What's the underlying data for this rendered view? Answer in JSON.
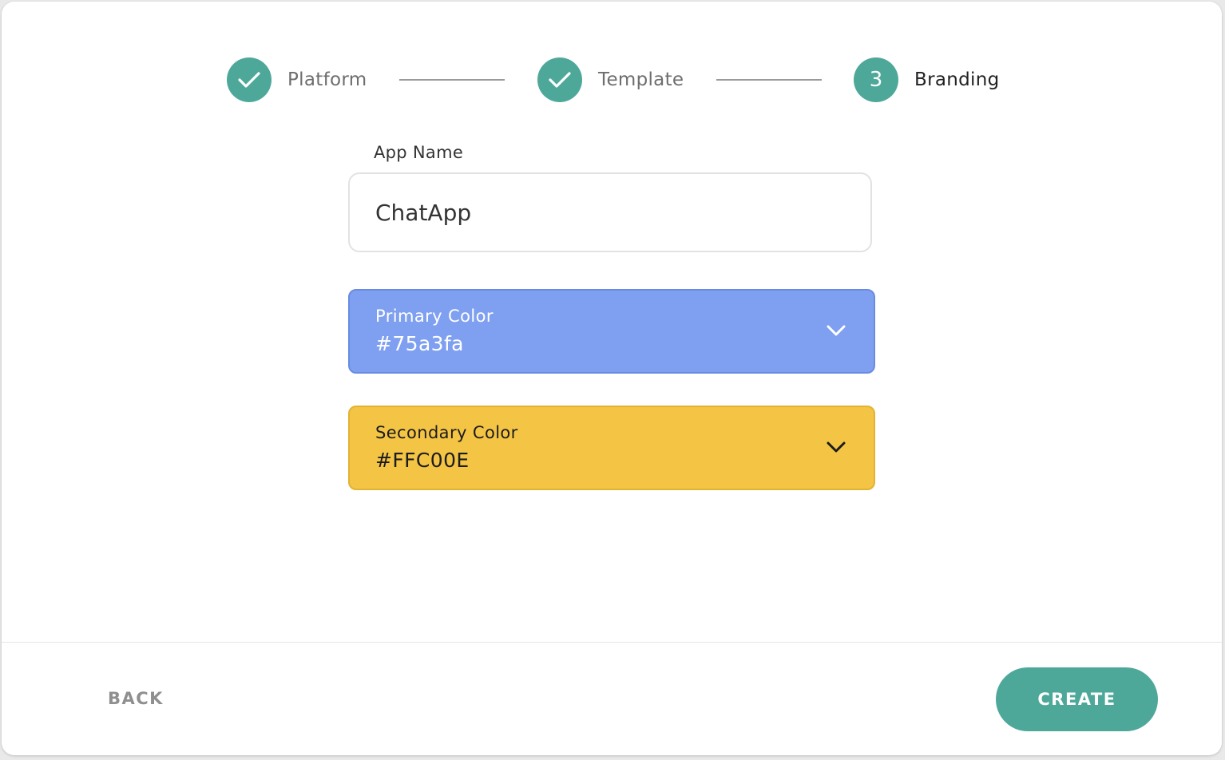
{
  "stepper": {
    "steps": [
      {
        "label": "Platform",
        "status": "completed",
        "icon": "checkmark-icon"
      },
      {
        "label": "Template",
        "status": "completed",
        "icon": "checkmark-icon"
      },
      {
        "label": "Branding",
        "status": "active",
        "number": "3"
      }
    ]
  },
  "form": {
    "app_name": {
      "label": "App Name",
      "value": "ChatApp"
    },
    "primary_color": {
      "label": "Primary Color",
      "value": "#75a3fa",
      "icon": "chevron-down-icon"
    },
    "secondary_color": {
      "label": "Secondary Color",
      "value": "#FFC00E",
      "icon": "chevron-down-icon"
    }
  },
  "footer": {
    "back_label": "BACK",
    "create_label": "CREATE"
  },
  "colors": {
    "accent": "#4ea89a",
    "primary_swatch": "#7fa0f0",
    "secondary_swatch": "#f4c445"
  }
}
